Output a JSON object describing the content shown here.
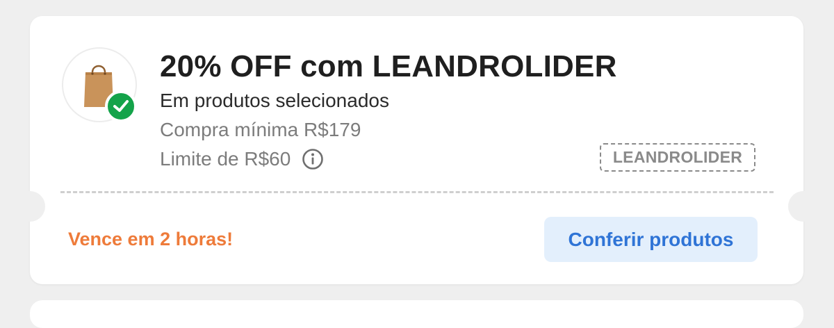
{
  "coupon": {
    "title": "20% OFF com LEANDROLIDER",
    "subtitle": "Em produtos selecionados",
    "min_purchase": "Compra mínima R$179",
    "limit": "Limite de R$60",
    "code": "LEANDROLIDER",
    "expires": "Vence em 2 horas!",
    "cta_label": "Conferir produtos",
    "icons": {
      "logo": "shopping-bag-icon",
      "badge": "check-icon",
      "info": "info-icon"
    },
    "colors": {
      "badge_green": "#14a34a",
      "expire_orange": "#ee7b3a",
      "cta_blue": "#2f74d6",
      "cta_bg": "#e3effc",
      "bag_brown": "#c9935a"
    }
  }
}
